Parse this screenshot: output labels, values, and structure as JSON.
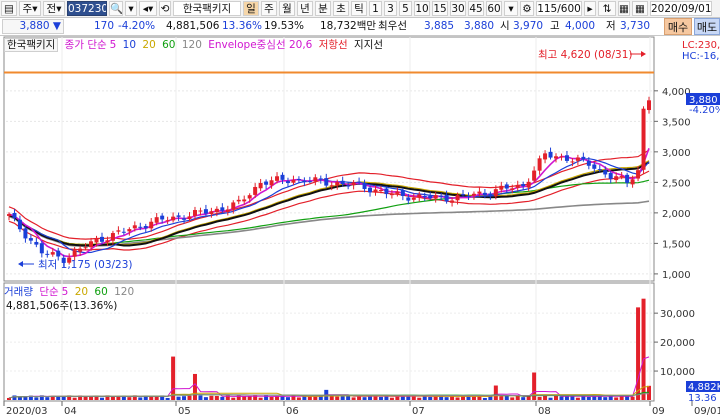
{
  "toolbar": {
    "stock_code": "037230",
    "stock_name": "한국팩키지",
    "type_label": "주",
    "prev_label": "전",
    "period_tabs": [
      "일",
      "주",
      "월",
      "년",
      "분",
      "초",
      "틱"
    ],
    "minutes": [
      "1",
      "3",
      "5",
      "10",
      "15",
      "30",
      "45",
      "60"
    ],
    "page_counter": "115/600",
    "date": "2020/09/01"
  },
  "infobar": {
    "price": "3,880",
    "change": "170",
    "change_pct": "-4.20%",
    "volume": "4,881,506",
    "vol_ratio": "13.36%",
    "turnover": "19.53%",
    "amount": "18,732백만",
    "ask_label": "최우선",
    "ask": "3,885",
    "bid": "3,880",
    "open_label": "시",
    "open": "3,970",
    "high_label": "고",
    "high": "4,000",
    "low_label": "저",
    "low": "3,730",
    "buy_button": "매수",
    "sell_button": "매도"
  },
  "legend": {
    "name": "한국팩키지",
    "close_label": "종가 단순",
    "ma": [
      "5",
      "10",
      "20",
      "60",
      "120"
    ],
    "envelope": "Envelope중심선 20,6",
    "resistance": "저항선",
    "support": "지지선"
  },
  "right_labels": {
    "lc": "LC:230,",
    "hc": "HC:-16,",
    "cur_price": "3,880",
    "cur_pct": "-4.20%",
    "vol_box": "4,882K",
    "vol_pct": "13.36"
  },
  "annotations": {
    "high": "최고 4,620 (08/31)",
    "low": "최저 1,175 (03/23)"
  },
  "volume_legend": {
    "label": "거래량",
    "avg_label": "단순",
    "ma": [
      "5",
      "20",
      "60",
      "120"
    ],
    "value": "4,881,506주(13.36%)"
  },
  "chart_data": [
    {
      "type": "candlestick",
      "title": "",
      "y_ticks": [
        "4,000",
        "3,500",
        "3,000",
        "2,500",
        "2,000",
        "1,500",
        "1,000"
      ],
      "ylim": [
        900,
        4800
      ],
      "resistance_level": 4300,
      "x_ticks": [
        "2020/03",
        "04",
        "05",
        "06",
        "07",
        "08",
        "09",
        "09/01"
      ],
      "series": [
        {
          "name": "종가 단순 5",
          "color": "#d016d0"
        },
        {
          "name": "10",
          "color": "#1b3fd8"
        },
        {
          "name": "20",
          "color": "#e0c000"
        },
        {
          "name": "60",
          "color": "#11a011"
        },
        {
          "name": "120",
          "color": "#888888"
        },
        {
          "name": "Envelope중심선 20,6",
          "color": "#e3202a"
        }
      ],
      "high_point": {
        "label": "최고 4,620 (08/31)",
        "value": 4620
      },
      "low_point": {
        "label": "최저 1,175 (03/23)",
        "value": 1175
      }
    },
    {
      "type": "bar",
      "title": "거래량",
      "y_ticks": [
        "30,000",
        "20,000",
        "10,000"
      ],
      "ylim": [
        0,
        38000
      ],
      "unit": "K"
    }
  ],
  "colors": {
    "up": "#e3202a",
    "down": "#1b3fd8",
    "resistance": "#f08a2e"
  }
}
